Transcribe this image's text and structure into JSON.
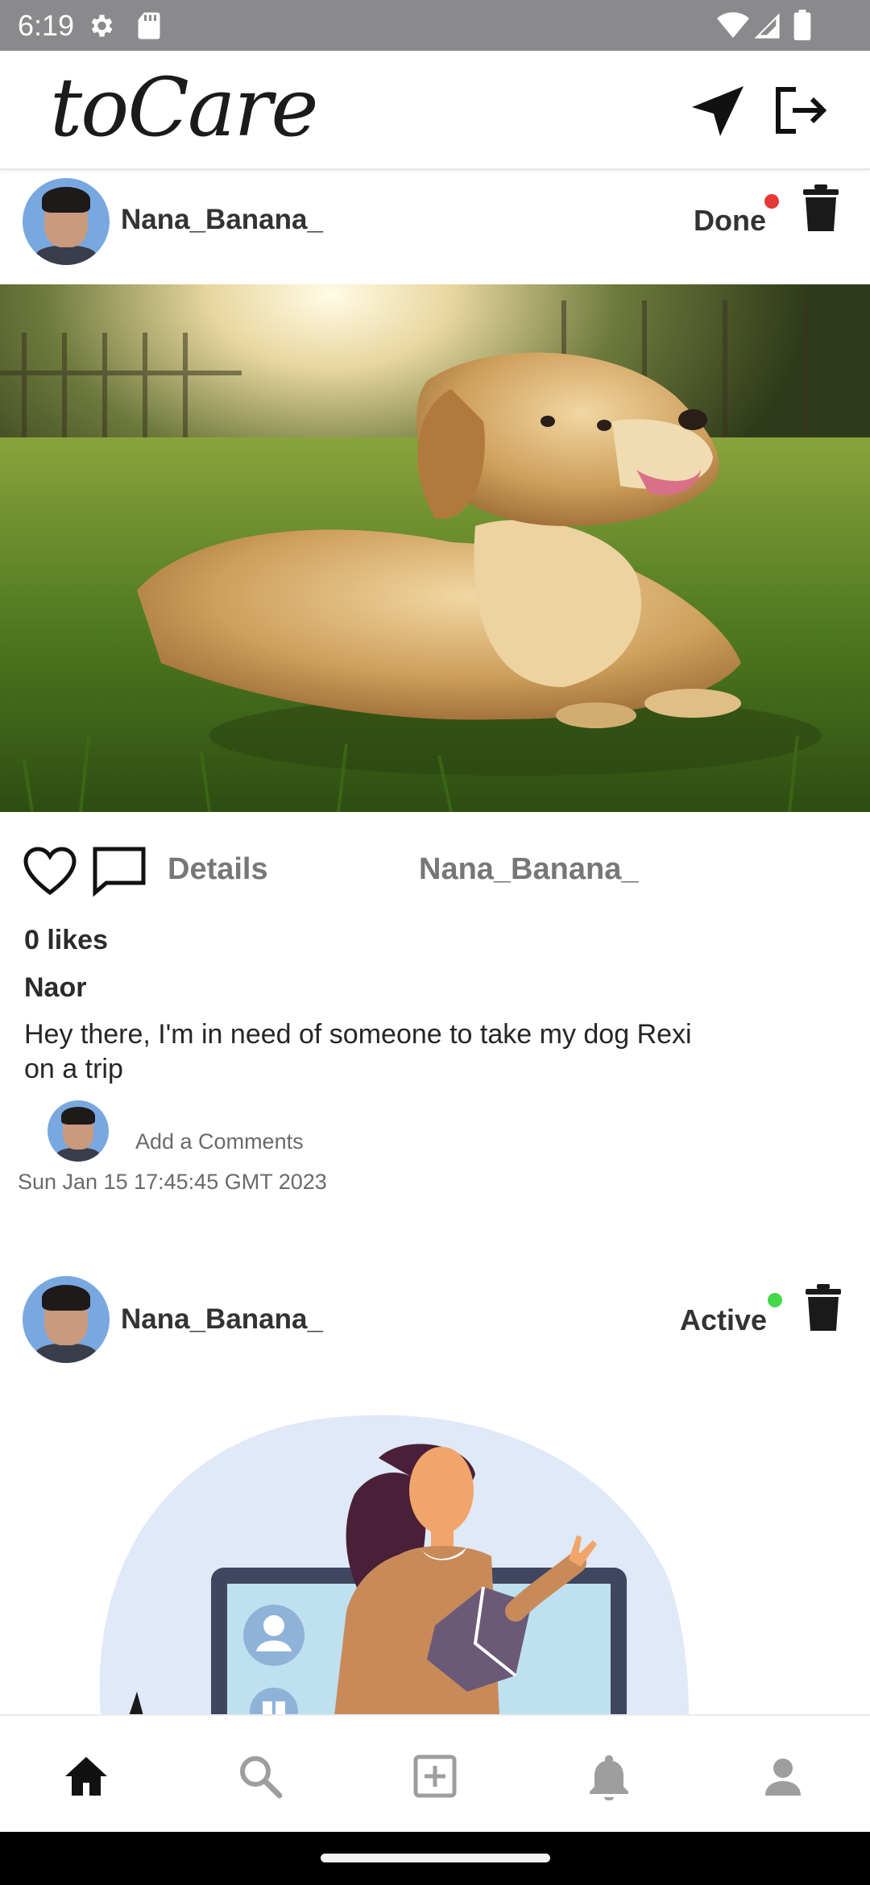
{
  "status_bar": {
    "time": "6:19",
    "icons": [
      "settings-icon",
      "sd-card-icon",
      "wifi-icon",
      "cellular-icon",
      "battery-icon"
    ]
  },
  "header": {
    "logo_text": "toCare",
    "actions": [
      "send-icon",
      "logout-icon"
    ]
  },
  "posts": [
    {
      "username": "Nana_Banana_",
      "status": "Done",
      "status_color": "#e53935",
      "image": "golden-retriever-photo",
      "details_label": "Details",
      "owner": "Nana_Banana_",
      "likes": "0 likes",
      "author": "Naor",
      "description": "Hey there, I'm in need of someone to take my dog Rexi on a trip",
      "comment_placeholder": "Add a Comments",
      "date": "Sun Jan 15 17:45:45 GMT 2023"
    },
    {
      "username": "Nana_Banana_",
      "status": "Active",
      "status_color": "#43d94a",
      "image": "person-at-laptop-illustration"
    }
  ],
  "bottom_nav": {
    "items": [
      "home-icon",
      "search-icon",
      "add-post-icon",
      "notifications-icon",
      "profile-icon"
    ],
    "active": "home-icon"
  }
}
